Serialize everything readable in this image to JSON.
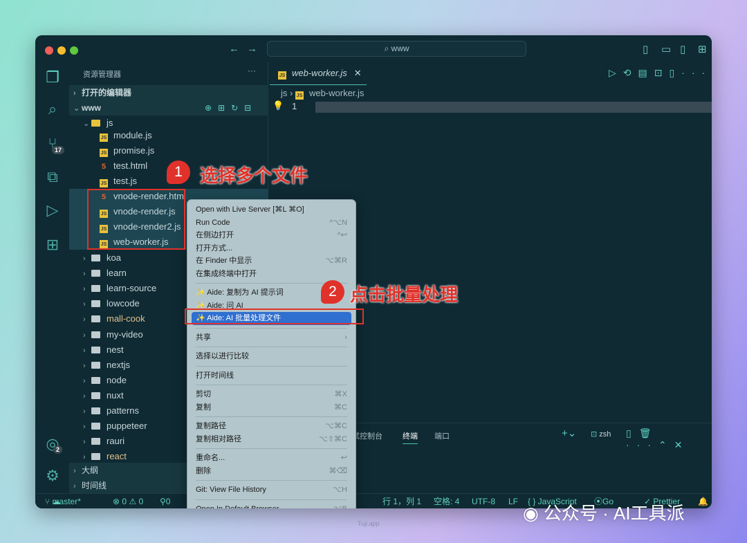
{
  "titlebar": {
    "search": "www"
  },
  "activity": {
    "scm_badge": "17",
    "accounts_badge": "2"
  },
  "sidebar": {
    "title": "资源管理器",
    "more": "···",
    "open_editors": "打开的编辑器",
    "root": "www",
    "folder_js": "js",
    "files": [
      {
        "name": "module.js",
        "type": "js"
      },
      {
        "name": "promise.js",
        "type": "js"
      },
      {
        "name": "test.html",
        "type": "html"
      },
      {
        "name": "test.js",
        "type": "js"
      },
      {
        "name": "vnode-render.html",
        "type": "html",
        "selected": true
      },
      {
        "name": "vnode-render.js",
        "type": "js",
        "selected": true
      },
      {
        "name": "vnode-render2.js",
        "type": "js",
        "selected": true
      },
      {
        "name": "web-worker.js",
        "type": "js",
        "selected": true
      }
    ],
    "folders": [
      "koa",
      "learn",
      "learn-source",
      "lowcode",
      "mall-cook",
      "my-video",
      "nest",
      "nextjs",
      "node",
      "nuxt",
      "patterns",
      "puppeteer",
      "rauri",
      "react"
    ],
    "outline": "大纲",
    "timeline": "时间线"
  },
  "editor": {
    "tab": "web-worker.js",
    "crumb_folder": "js",
    "crumb_file": "web-worker.js",
    "line_number": "1"
  },
  "panel": {
    "tabs": [
      "调试控制台",
      "终端",
      "端口"
    ],
    "active": "终端",
    "shell": "zsh"
  },
  "menu": {
    "items": [
      {
        "label": "Open with Live Server [⌘L ⌘O]",
        "shortcut": ""
      },
      {
        "label": "Run Code",
        "shortcut": "^⌥N"
      },
      {
        "label": "在侧边打开",
        "shortcut": "^↩"
      },
      {
        "label": "打开方式...",
        "shortcut": ""
      },
      {
        "label": "在 Finder 中显示",
        "shortcut": "⌥⌘R"
      },
      {
        "label": "在集成终端中打开",
        "shortcut": ""
      },
      {
        "sep": true
      },
      {
        "label": "Aide: 复制为 AI 提示词",
        "shortcut": "",
        "star": true
      },
      {
        "label": "Aide: 问 AI",
        "shortcut": "",
        "star": true
      },
      {
        "label": "Aide: AI 批量处理文件",
        "shortcut": "",
        "star": true,
        "highlight": true
      },
      {
        "sep": true
      },
      {
        "label": "共享",
        "shortcut": "›"
      },
      {
        "sep": true
      },
      {
        "label": "选择以进行比较",
        "shortcut": ""
      },
      {
        "sep": true
      },
      {
        "label": "打开时间线",
        "shortcut": ""
      },
      {
        "sep": true
      },
      {
        "label": "剪切",
        "shortcut": "⌘X"
      },
      {
        "label": "复制",
        "shortcut": "⌘C"
      },
      {
        "sep": true
      },
      {
        "label": "复制路径",
        "shortcut": "⌥⌘C"
      },
      {
        "label": "复制相对路径",
        "shortcut": "⌥⇧⌘C"
      },
      {
        "sep": true
      },
      {
        "label": "重命名...",
        "shortcut": "↩"
      },
      {
        "label": "删除",
        "shortcut": "⌘⌫"
      },
      {
        "sep": true
      },
      {
        "label": "Git: View File History",
        "shortcut": "⌥H"
      },
      {
        "sep": true
      },
      {
        "label": "Open In Default Browser",
        "shortcut": "⌥B"
      }
    ]
  },
  "status": {
    "branch": "master*",
    "errors": "⊗ 0 ⚠ 0",
    "ports": "0",
    "position": "行 1，列 1",
    "spaces": "空格: 4",
    "encoding": "UTF-8",
    "eol": "LF",
    "language": "{ } JavaScript",
    "golive": "Go Live",
    "prettier": "✓ Prettier"
  },
  "annotations": {
    "step1_num": "1",
    "step1_text": "选择多个文件",
    "step2_num": "2",
    "step2_text": "点击批量处理",
    "color": "#e0322a"
  },
  "watermark": {
    "text": "公众号 · AI工具派",
    "site": "Tuji.app"
  }
}
